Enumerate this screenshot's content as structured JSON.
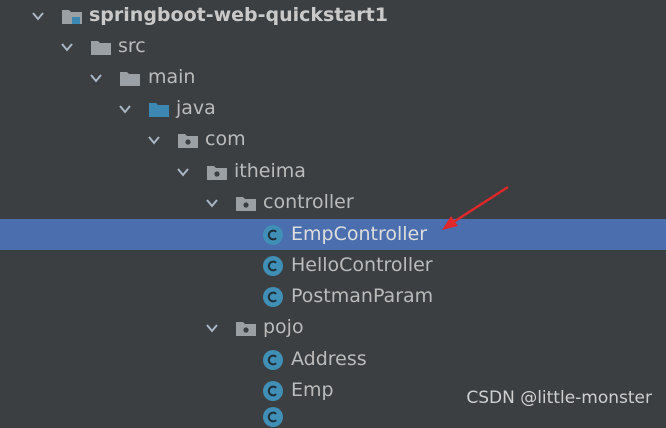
{
  "tree": {
    "project": "springboot-web-quickstart1",
    "src": "src",
    "main": "main",
    "java": "java",
    "com": "com",
    "itheima": "itheima",
    "controller": "controller",
    "emp_controller": "EmpController",
    "hello_controller": "HelloController",
    "postman_param": "PostmanParam",
    "pojo": "pojo",
    "address": "Address",
    "emp": "Emp"
  },
  "watermark": "CSDN @little-monster",
  "colors": {
    "background": "#3c3f41",
    "selection": "#4b6eaf",
    "class_icon": "#3f8fb6",
    "source_folder_icon": "#3d87b3",
    "folder_icon": "#9aa0a4",
    "annotation_arrow": "#e0282a"
  },
  "icons": {
    "expanded": "chevron-down-icon",
    "module": "module-folder-icon",
    "folder": "folder-icon",
    "source_root": "source-root-folder-icon",
    "package": "package-icon",
    "class": "java-class-icon"
  }
}
